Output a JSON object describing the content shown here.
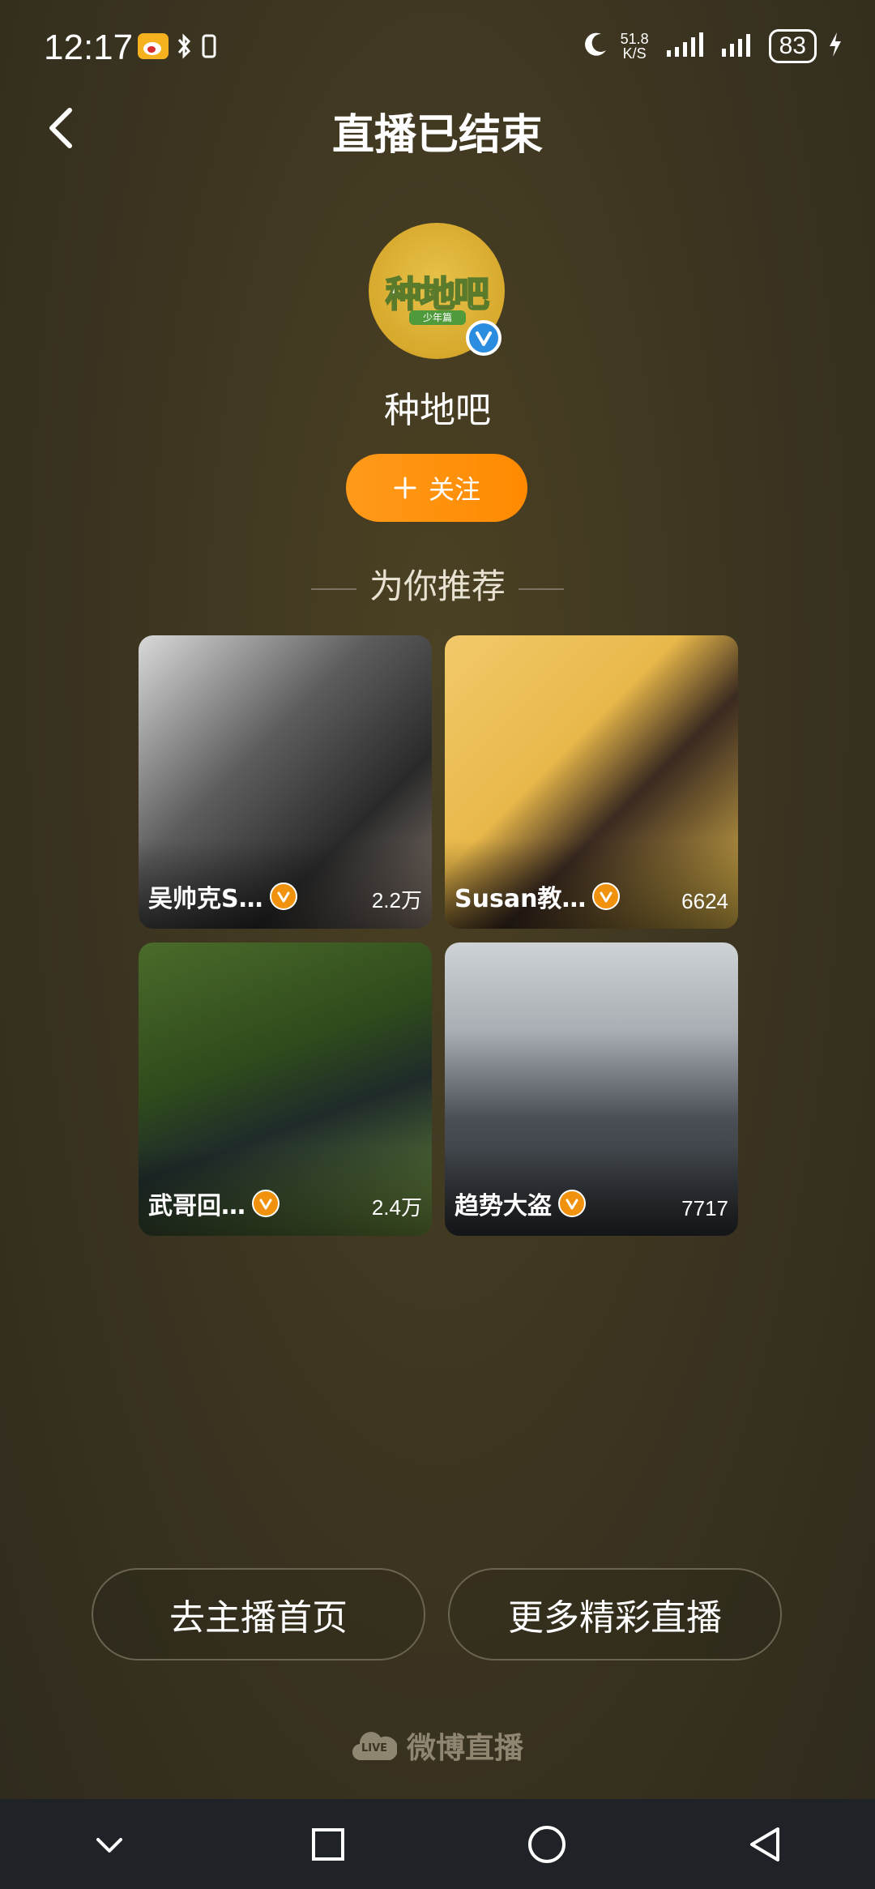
{
  "status_bar": {
    "time": "12:17",
    "net_speed_value": "51.8",
    "net_speed_unit": "K/S",
    "battery": "83"
  },
  "header": {
    "title": "直播已结束"
  },
  "streamer": {
    "avatar_text": "种地吧",
    "avatar_subtext": "少年篇",
    "name": "种地吧",
    "follow_label": "关注"
  },
  "recommend": {
    "heading": "为你推荐",
    "cards": [
      {
        "name": "吴帅克S…",
        "count": "2.2万",
        "bg": "linear-gradient(135deg,#d9d9d9 0%,#5c5c5c 40%,#2a2a2a 70%,#8a7a70 100%)"
      },
      {
        "name": "Susan教…",
        "count": "6624",
        "bg": "linear-gradient(135deg,#f2c96a 0%,#e8b84a 40%,#3a2a20 60%,#e0b84a 100%)"
      },
      {
        "name": "武哥回…",
        "count": "2.4万",
        "bg": "linear-gradient(160deg,#4a6b2a 0%,#2f4a1c 40%,#1f2b2a 60%,#6a8a3a 100%)"
      },
      {
        "name": "趋势大盗",
        "count": "7717",
        "bg": "linear-gradient(180deg,#cfd3d6 0%,#a8aeb3 30%,#4a4f55 60%,#2b2e33 100%)"
      }
    ]
  },
  "actions": {
    "home_label": "去主播首页",
    "more_label": "更多精彩直播"
  },
  "brand": {
    "name": "微博直播",
    "logo_text": "LIVE"
  },
  "colors": {
    "accent": "#ff9a1a",
    "verify_blue": "#2b8de0",
    "verify_orange": "#f0920e"
  }
}
